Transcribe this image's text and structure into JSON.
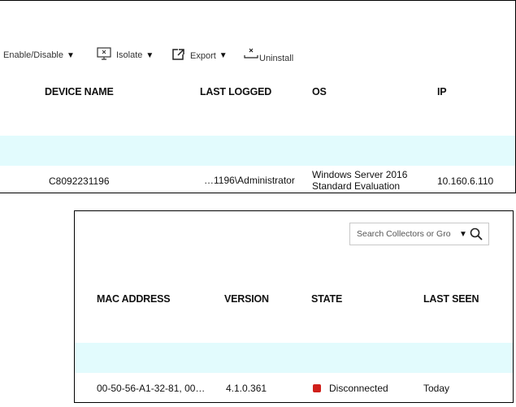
{
  "toolbar": {
    "enable_disable": "Enable/Disable",
    "isolate": "Isolate",
    "export": "Export",
    "uninstall": "Uninstall",
    "caret": "▼"
  },
  "top_table": {
    "headers": [
      "DEVICE NAME",
      "LAST LOGGED",
      "OS",
      "IP"
    ],
    "row": {
      "device_name": "C8092231196",
      "last_logged": "…1196\\Administrator",
      "os_line1": "Windows Server 2016",
      "os_line2": "Standard Evaluation",
      "ip": "10.160.6.110"
    }
  },
  "search": {
    "placeholder": "Search Collectors or Gro",
    "caret": "▼"
  },
  "bottom_table": {
    "headers": [
      "MAC ADDRESS",
      "VERSION",
      "STATE",
      "LAST SEEN"
    ],
    "row": {
      "mac_address": "00-50-56-A1-32-81, 00…",
      "version": "4.1.0.361",
      "state": "Disconnected",
      "last_seen": "Today"
    }
  },
  "colors": {
    "band": "#e2fbfd",
    "state_disconnected": "#d0201b"
  }
}
